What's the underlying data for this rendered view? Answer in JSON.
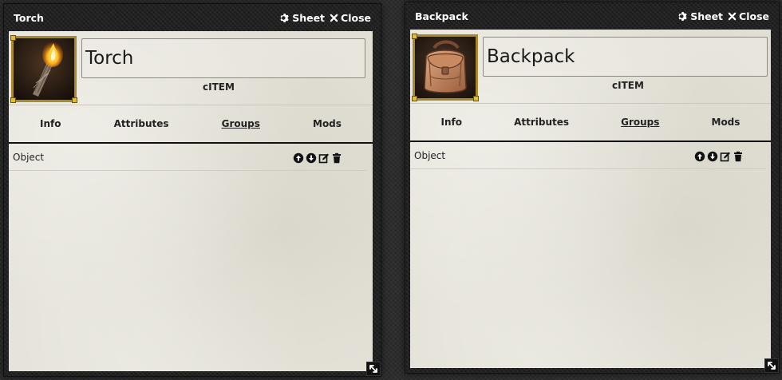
{
  "windows": {
    "torch": {
      "title": "Torch",
      "sheet_label": "Sheet",
      "close_label": "Close",
      "item_name": "Torch",
      "item_type": "cITEM",
      "image_icon": "torch-image",
      "tabs": [
        {
          "label": "Info",
          "active": false
        },
        {
          "label": "Attributes",
          "active": false
        },
        {
          "label": "Groups",
          "active": true
        },
        {
          "label": "Mods",
          "active": false
        }
      ],
      "groups": [
        {
          "label": "Object",
          "actions": [
            "move-up-icon",
            "move-down-icon",
            "edit-icon",
            "delete-icon"
          ]
        }
      ]
    },
    "backpack": {
      "title": "Backpack",
      "sheet_label": "Sheet",
      "close_label": "Close",
      "item_name": "Backpack",
      "item_type": "cITEM",
      "image_icon": "backpack-image",
      "tabs": [
        {
          "label": "Info",
          "active": false
        },
        {
          "label": "Attributes",
          "active": false
        },
        {
          "label": "Groups",
          "active": true
        },
        {
          "label": "Mods",
          "active": false
        }
      ],
      "groups": [
        {
          "label": "Object",
          "actions": [
            "move-up-icon",
            "move-down-icon",
            "edit-icon",
            "delete-icon"
          ]
        }
      ]
    }
  },
  "colors": {
    "window_frame": "#1f1f1f",
    "parchment": "#e5e3d9",
    "portrait_border": "#a88a2d",
    "portrait_corner": "#e2bb2f",
    "text": "#222222"
  }
}
